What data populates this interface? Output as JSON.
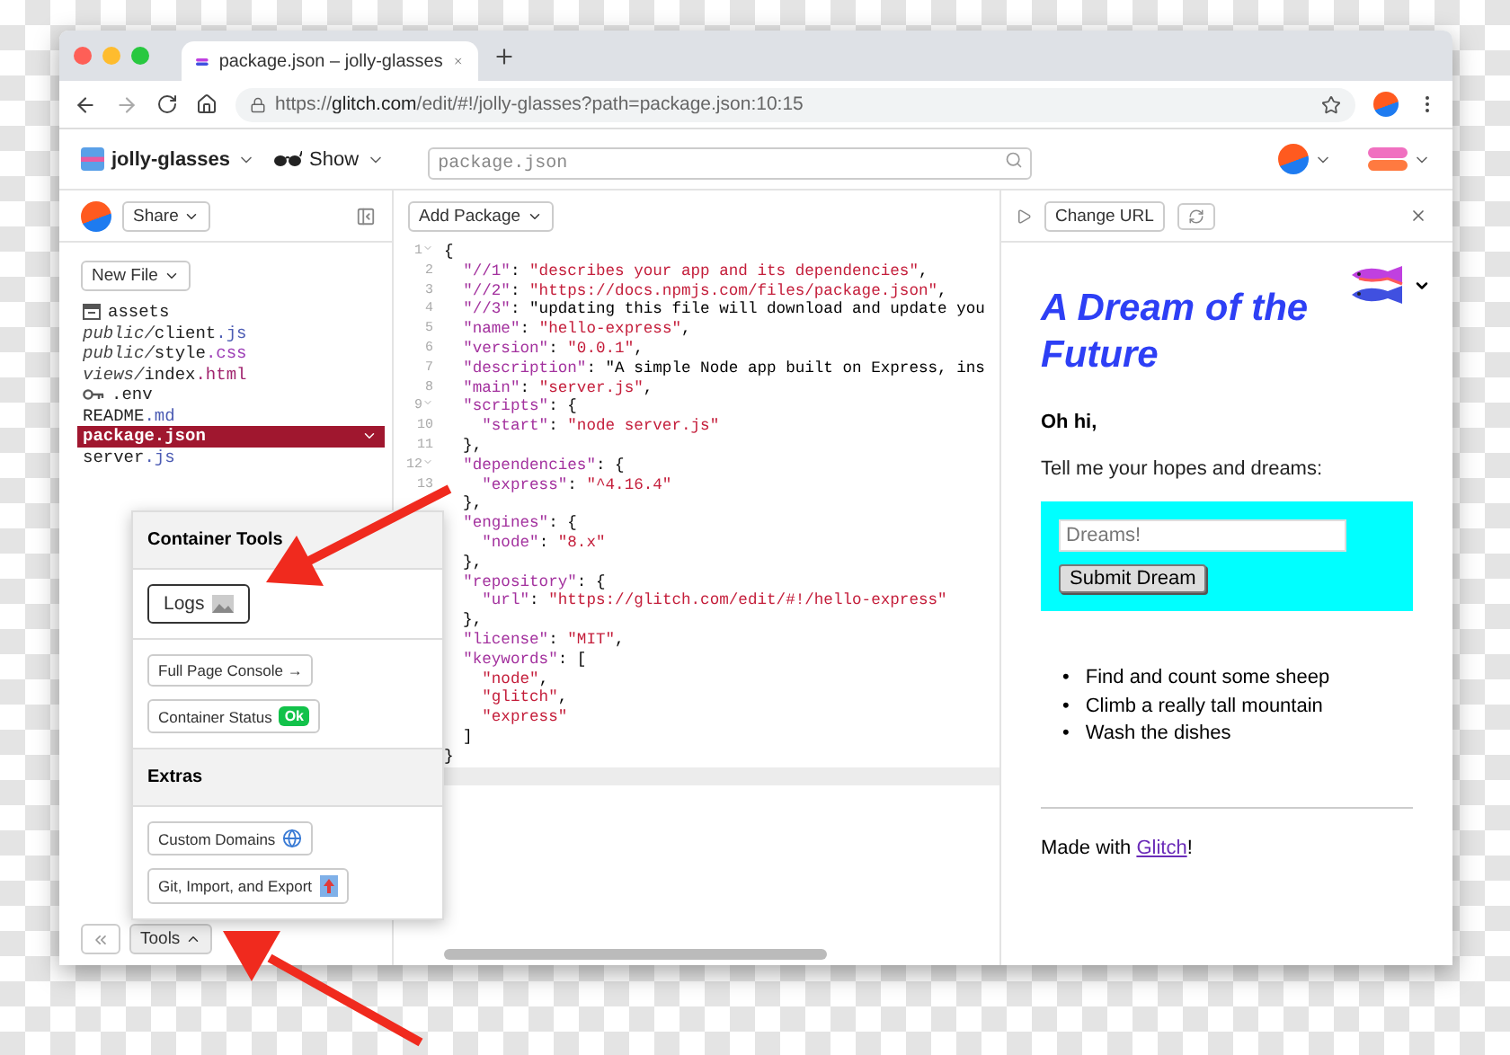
{
  "browser": {
    "tab_title": "package.json – jolly-glasses",
    "url_scheme": "https://",
    "url_host": "glitch.com",
    "url_path": "/edit/#!/jolly-glasses?path=package.json:10:15"
  },
  "header": {
    "project": "jolly-glasses",
    "show": "Show",
    "search_placeholder": "package.json"
  },
  "sidebar": {
    "share": "Share",
    "new_file": "New File",
    "tools": "Tools",
    "files": [
      {
        "kind": "folder",
        "name": "assets",
        "selected": false
      },
      {
        "folder": "public/",
        "name": "client",
        "ext": ".js",
        "color": "#4b5bb3",
        "selected": false
      },
      {
        "folder": "public/",
        "name": "style",
        "ext": ".css",
        "color": "#9b3bb5",
        "selected": false
      },
      {
        "folder": "views/",
        "name": "index",
        "ext": ".html",
        "color": "#a0246e",
        "selected": false
      },
      {
        "kind": "env",
        "name": ".env",
        "selected": false
      },
      {
        "name": "README",
        "ext": ".md",
        "color": "#4b5bb3",
        "selected": false
      },
      {
        "name": "package.json",
        "selected": true
      },
      {
        "name": "server",
        "ext": ".js",
        "color": "#4b5bb3",
        "selected": false
      }
    ]
  },
  "editor": {
    "add_package": "Add Package",
    "lines": [
      {
        "num": "1",
        "fold": true,
        "text": "{"
      },
      {
        "num": "2",
        "fold": false,
        "text": "  \"//1\": \"describes your app and its dependencies\","
      },
      {
        "num": "3",
        "fold": false,
        "text": "  \"//2\": \"https://docs.npmjs.com/files/package.json\","
      },
      {
        "num": "4",
        "fold": false,
        "text": "  \"//3\": \"updating this file will download and update you"
      },
      {
        "num": "5",
        "fold": false,
        "text": "  \"name\": \"hello-express\","
      },
      {
        "num": "6",
        "fold": false,
        "text": "  \"version\": \"0.0.1\","
      },
      {
        "num": "7",
        "fold": false,
        "text": "  \"description\": \"A simple Node app built on Express, ins"
      },
      {
        "num": "8",
        "fold": false,
        "text": "  \"main\": \"server.js\","
      },
      {
        "num": "9",
        "fold": true,
        "text": "  \"scripts\": {"
      },
      {
        "num": "10",
        "fold": false,
        "text": "    \"start\": \"node server.js\""
      },
      {
        "num": "11",
        "fold": false,
        "text": "  },"
      },
      {
        "num": "12",
        "fold": true,
        "text": "  \"dependencies\": {"
      },
      {
        "num": "13",
        "fold": false,
        "text": "    \"express\": \"^4.16.4\""
      },
      {
        "text": "  },"
      },
      {
        "text": "  \"engines\": {"
      },
      {
        "text": "    \"node\": \"8.x\""
      },
      {
        "text": "  },"
      },
      {
        "text": "  \"repository\": {"
      },
      {
        "text": "    \"url\": \"https://glitch.com/edit/#!/hello-express\""
      },
      {
        "text": "  },"
      },
      {
        "text": "  \"license\": \"MIT\","
      },
      {
        "text": "  \"keywords\": ["
      },
      {
        "text": "    \"node\","
      },
      {
        "text": "    \"glitch\","
      },
      {
        "text": "    \"express\""
      },
      {
        "text": "  ]"
      },
      {
        "text": "}"
      }
    ]
  },
  "preview": {
    "change_url": "Change URL",
    "title": "A Dream of the Future",
    "greeting": "Oh hi,",
    "prompt": "Tell me your hopes and dreams:",
    "input_placeholder": "Dreams!",
    "submit": "Submit Dream",
    "dreams": [
      {
        "bullet": "•",
        "text": "Find and count some sheep"
      },
      {
        "bullet": "•",
        "text": "Climb a really tall mountain"
      },
      {
        "bullet": "•",
        "text": "Wash the dishes"
      }
    ],
    "footer": "Made with ",
    "footer_link": "Glitch",
    "footer_end": "!"
  },
  "tools_popup": {
    "sections": [
      {
        "heading": "Container Tools",
        "groups": [
          [
            {
              "label": "Logs",
              "kind": "logs",
              "focused": true
            }
          ],
          [
            {
              "label": "Full Page Console →",
              "kind": "console",
              "focused": false
            },
            {
              "label": "Container Status",
              "kind": "status",
              "focused": false,
              "badge": "Ok"
            }
          ]
        ]
      },
      {
        "heading": "Extras",
        "groups": [
          [
            {
              "label": "Custom Domains",
              "kind": "domains",
              "focused": false
            },
            {
              "label": "Git, Import, and Export",
              "kind": "git",
              "focused": false
            }
          ]
        ]
      }
    ]
  }
}
